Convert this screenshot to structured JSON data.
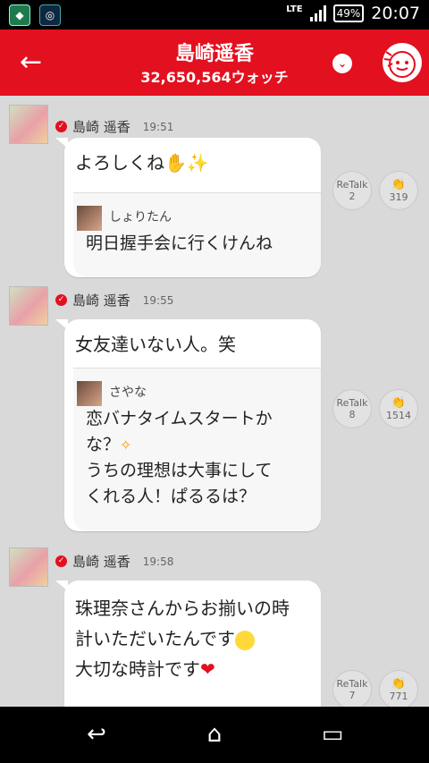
{
  "status_bar": {
    "network": "LTE",
    "battery": "49%",
    "time": "20:07"
  },
  "header": {
    "title": "島崎遥香",
    "watch_count": "32,650,564ウォッチ"
  },
  "colors": {
    "brand_red": "#e3101f",
    "background": "#d9d9d9"
  },
  "messages": [
    {
      "name": "島崎 遥香",
      "time": "19:51",
      "text": "よろしくね",
      "quote": {
        "name": "しょりたん",
        "lines": [
          "明日握手会に行くけんね"
        ]
      },
      "retalk_label": "ReTalk",
      "retalk": "2",
      "claps": "319"
    },
    {
      "name": "島崎 遥香",
      "time": "19:55",
      "text": "女友達いない人。笑",
      "quote": {
        "name": "さやな",
        "lines": [
          "恋バナタイムスタートか",
          "な？",
          "うちの理想は大事にして",
          "くれる人！ぱるるは？"
        ]
      },
      "retalk_label": "ReTalk",
      "retalk": "8",
      "claps": "1514"
    },
    {
      "name": "島崎 遥香",
      "time": "19:58",
      "lines": [
        "珠理奈さんからお揃いの時",
        "計いただいたんです",
        "大切な時計です"
      ],
      "retalk_label": "ReTalk",
      "retalk": "7",
      "claps": "771"
    }
  ],
  "icons": [
    "back-arrow-icon",
    "dropdown-icon",
    "mascot-icon",
    "verified-icon",
    "clap-icon",
    "nav-back-icon",
    "nav-home-icon",
    "nav-recents-icon"
  ]
}
